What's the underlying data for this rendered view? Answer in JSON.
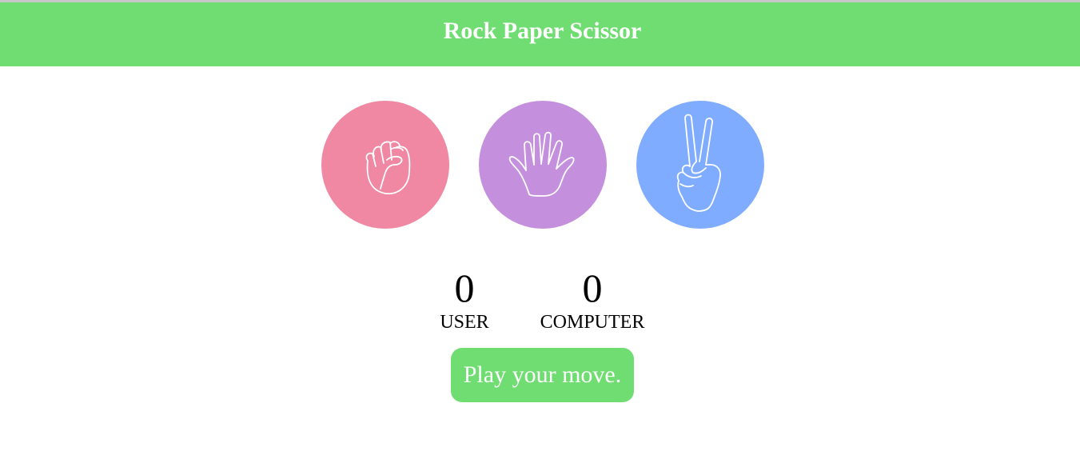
{
  "header": {
    "title": "Rock Paper Scissor"
  },
  "choices": [
    {
      "id": "rock",
      "icon": "rock-hand-icon",
      "color": "#f087a3"
    },
    {
      "id": "paper",
      "icon": "paper-hand-icon",
      "color": "#c48fdd"
    },
    {
      "id": "scissor",
      "icon": "scissor-hand-icon",
      "color": "#80acff"
    }
  ],
  "scores": {
    "user": {
      "value": "0",
      "label": "USER"
    },
    "computer": {
      "value": "0",
      "label": "COMPUTER"
    }
  },
  "message": {
    "text": "Play your move.",
    "color": "#6fdd71"
  }
}
